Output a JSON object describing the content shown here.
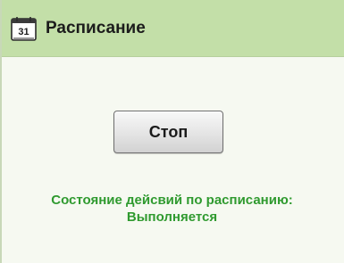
{
  "header": {
    "icon": "calendar-icon",
    "icon_day": "31",
    "title": "Расписание"
  },
  "controls": {
    "stop_label": "Стоп"
  },
  "status": {
    "label": "Состояние дейсвий по расписанию:",
    "value": "Выполняется"
  },
  "colors": {
    "header_bg": "#c3dfa8",
    "body_bg": "#f6f9f1",
    "status_text": "#2f9a2f"
  }
}
